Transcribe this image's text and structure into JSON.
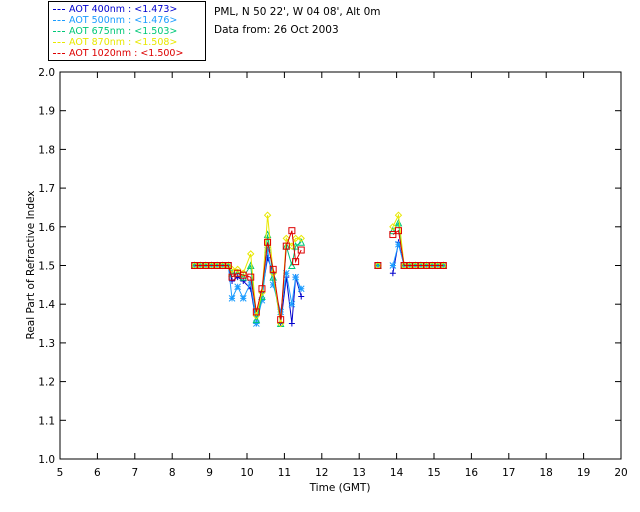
{
  "header": {
    "location": "PML, N 50 22', W 04 08', Alt 0m",
    "date": "Data from: 26 Oct 2003"
  },
  "legend": [
    {
      "label": "AOT  400nm : <1.473>",
      "color": "#0000cc"
    },
    {
      "label": "AOT  500nm : <1.476>",
      "color": "#1a9cff"
    },
    {
      "label": "AOT  675nm : <1.503>",
      "color": "#00c878"
    },
    {
      "label": "AOT  870nm : <1.508>",
      "color": "#e8e800"
    },
    {
      "label": "AOT 1020nm : <1.500>",
      "color": "#dd0000"
    }
  ],
  "chart_data": {
    "type": "line",
    "title": "",
    "xlabel": "Time (GMT)",
    "ylabel": "Real Part of Refractive Index",
    "xlim": [
      5,
      20
    ],
    "ylim": [
      1.0,
      2.0
    ],
    "xticks": [
      "5",
      "6",
      "7",
      "8",
      "9",
      "10",
      "11",
      "12",
      "13",
      "14",
      "15",
      "16",
      "17",
      "18",
      "19",
      "20"
    ],
    "yticks": [
      "1.0",
      "1.1",
      "1.2",
      "1.3",
      "1.4",
      "1.5",
      "1.6",
      "1.7",
      "1.8",
      "1.9",
      "2.0"
    ],
    "series": [
      {
        "name": "AOT  400nm : <1.473>",
        "color": "#0000cc",
        "marker": "plus",
        "segments": [
          [
            [
              8.6,
              1.5
            ],
            [
              8.75,
              1.5
            ],
            [
              8.9,
              1.5
            ],
            [
              9.05,
              1.5
            ],
            [
              9.2,
              1.5
            ],
            [
              9.35,
              1.5
            ],
            [
              9.5,
              1.5
            ],
            [
              9.6,
              1.46
            ],
            [
              9.75,
              1.47
            ],
            [
              9.9,
              1.46
            ],
            [
              10.1,
              1.44
            ],
            [
              10.25,
              1.35
            ],
            [
              10.4,
              1.43
            ],
            [
              10.55,
              1.52
            ],
            [
              10.7,
              1.48
            ],
            [
              10.9,
              1.35
            ],
            [
              11.05,
              1.47
            ],
            [
              11.2,
              1.35
            ],
            [
              11.3,
              1.47
            ],
            [
              11.45,
              1.42
            ]
          ],
          [
            [
              13.5,
              1.5
            ]
          ],
          [
            [
              13.9,
              1.48
            ],
            [
              14.05,
              1.56
            ],
            [
              14.2,
              1.5
            ],
            [
              14.35,
              1.5
            ],
            [
              14.5,
              1.5
            ],
            [
              14.65,
              1.5
            ],
            [
              14.8,
              1.5
            ],
            [
              14.95,
              1.5
            ],
            [
              15.1,
              1.5
            ],
            [
              15.25,
              1.5
            ]
          ]
        ]
      },
      {
        "name": "AOT  500nm : <1.476>",
        "color": "#1a9cff",
        "marker": "star",
        "segments": [
          [
            [
              8.6,
              1.5
            ],
            [
              8.75,
              1.5
            ],
            [
              8.9,
              1.5
            ],
            [
              9.05,
              1.5
            ],
            [
              9.2,
              1.5
            ],
            [
              9.35,
              1.5
            ],
            [
              9.5,
              1.5
            ],
            [
              9.6,
              1.415
            ],
            [
              9.75,
              1.445
            ],
            [
              9.9,
              1.415
            ],
            [
              10.1,
              1.455
            ],
            [
              10.25,
              1.35
            ],
            [
              10.4,
              1.41
            ],
            [
              10.55,
              1.54
            ],
            [
              10.7,
              1.45
            ],
            [
              10.9,
              1.38
            ],
            [
              11.05,
              1.48
            ],
            [
              11.2,
              1.4
            ],
            [
              11.3,
              1.47
            ],
            [
              11.45,
              1.44
            ]
          ],
          [
            [
              13.5,
              1.5
            ]
          ],
          [
            [
              13.9,
              1.5
            ],
            [
              14.05,
              1.555
            ],
            [
              14.2,
              1.5
            ],
            [
              14.35,
              1.5
            ],
            [
              14.5,
              1.5
            ],
            [
              14.65,
              1.5
            ],
            [
              14.8,
              1.5
            ],
            [
              14.95,
              1.5
            ],
            [
              15.1,
              1.5
            ],
            [
              15.25,
              1.5
            ]
          ]
        ]
      },
      {
        "name": "AOT  675nm : <1.503>",
        "color": "#00c878",
        "marker": "triangle",
        "segments": [
          [
            [
              8.6,
              1.5
            ],
            [
              8.75,
              1.5
            ],
            [
              8.9,
              1.5
            ],
            [
              9.05,
              1.5
            ],
            [
              9.2,
              1.5
            ],
            [
              9.35,
              1.5
            ],
            [
              9.5,
              1.5
            ],
            [
              9.6,
              1.48
            ],
            [
              9.75,
              1.48
            ],
            [
              9.9,
              1.47
            ],
            [
              10.1,
              1.5
            ],
            [
              10.25,
              1.36
            ],
            [
              10.4,
              1.42
            ],
            [
              10.55,
              1.58
            ],
            [
              10.7,
              1.47
            ],
            [
              10.9,
              1.35
            ],
            [
              11.05,
              1.55
            ],
            [
              11.2,
              1.5
            ],
            [
              11.3,
              1.55
            ],
            [
              11.45,
              1.56
            ]
          ],
          [
            [
              13.5,
              1.5
            ]
          ],
          [
            [
              13.9,
              1.59
            ],
            [
              14.05,
              1.61
            ],
            [
              14.2,
              1.5
            ],
            [
              14.35,
              1.5
            ],
            [
              14.5,
              1.5
            ],
            [
              14.65,
              1.5
            ],
            [
              14.8,
              1.5
            ],
            [
              14.95,
              1.5
            ],
            [
              15.1,
              1.5
            ],
            [
              15.25,
              1.5
            ]
          ]
        ]
      },
      {
        "name": "AOT  870nm : <1.508>",
        "color": "#e8e800",
        "marker": "diamond",
        "segments": [
          [
            [
              8.6,
              1.5
            ],
            [
              8.75,
              1.5
            ],
            [
              8.9,
              1.5
            ],
            [
              9.05,
              1.5
            ],
            [
              9.2,
              1.5
            ],
            [
              9.35,
              1.5
            ],
            [
              9.5,
              1.5
            ],
            [
              9.6,
              1.49
            ],
            [
              9.75,
              1.49
            ],
            [
              9.9,
              1.48
            ],
            [
              10.1,
              1.53
            ],
            [
              10.25,
              1.37
            ],
            [
              10.4,
              1.43
            ],
            [
              10.55,
              1.63
            ],
            [
              10.7,
              1.48
            ],
            [
              10.9,
              1.35
            ],
            [
              11.05,
              1.57
            ],
            [
              11.2,
              1.55
            ],
            [
              11.3,
              1.57
            ],
            [
              11.45,
              1.57
            ]
          ],
          [
            [
              13.5,
              1.5
            ]
          ],
          [
            [
              13.9,
              1.6
            ],
            [
              14.05,
              1.63
            ],
            [
              14.2,
              1.5
            ],
            [
              14.35,
              1.5
            ],
            [
              14.5,
              1.5
            ],
            [
              14.65,
              1.5
            ],
            [
              14.8,
              1.5
            ],
            [
              14.95,
              1.5
            ],
            [
              15.1,
              1.5
            ],
            [
              15.25,
              1.5
            ]
          ]
        ]
      },
      {
        "name": "AOT 1020nm : <1.500>",
        "color": "#dd0000",
        "marker": "square",
        "segments": [
          [
            [
              8.6,
              1.5
            ],
            [
              8.75,
              1.5
            ],
            [
              8.9,
              1.5
            ],
            [
              9.05,
              1.5
            ],
            [
              9.2,
              1.5
            ],
            [
              9.35,
              1.5
            ],
            [
              9.5,
              1.5
            ],
            [
              9.6,
              1.47
            ],
            [
              9.75,
              1.48
            ],
            [
              9.9,
              1.475
            ],
            [
              10.1,
              1.47
            ],
            [
              10.25,
              1.38
            ],
            [
              10.4,
              1.44
            ],
            [
              10.55,
              1.56
            ],
            [
              10.7,
              1.49
            ],
            [
              10.9,
              1.36
            ],
            [
              11.05,
              1.55
            ],
            [
              11.2,
              1.59
            ],
            [
              11.3,
              1.51
            ],
            [
              11.45,
              1.54
            ]
          ],
          [
            [
              13.5,
              1.5
            ]
          ],
          [
            [
              13.9,
              1.58
            ],
            [
              14.05,
              1.59
            ],
            [
              14.2,
              1.5
            ],
            [
              14.35,
              1.5
            ],
            [
              14.5,
              1.5
            ],
            [
              14.65,
              1.5
            ],
            [
              14.8,
              1.5
            ],
            [
              14.95,
              1.5
            ],
            [
              15.1,
              1.5
            ],
            [
              15.25,
              1.5
            ]
          ]
        ]
      }
    ]
  }
}
